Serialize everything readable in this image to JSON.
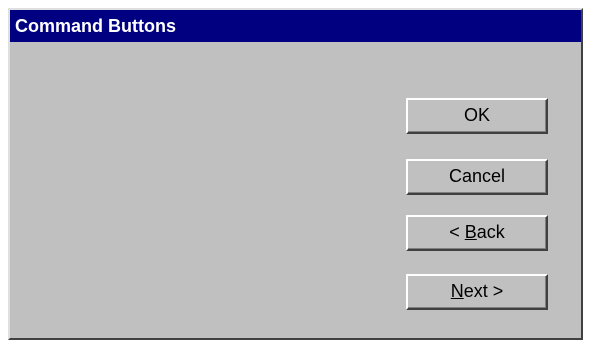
{
  "window": {
    "title": "Command Buttons"
  },
  "buttons": {
    "ok": {
      "label": "OK"
    },
    "cancel": {
      "label": "Cancel"
    },
    "back": {
      "prefix": "< ",
      "mnemonic": "B",
      "rest": "ack"
    },
    "next": {
      "prefix": "",
      "mnemonic": "N",
      "rest": "ext >"
    }
  },
  "colors": {
    "titlebar": "#000080",
    "window_face": "#c0c0c0",
    "title_text": "#ffffff"
  }
}
